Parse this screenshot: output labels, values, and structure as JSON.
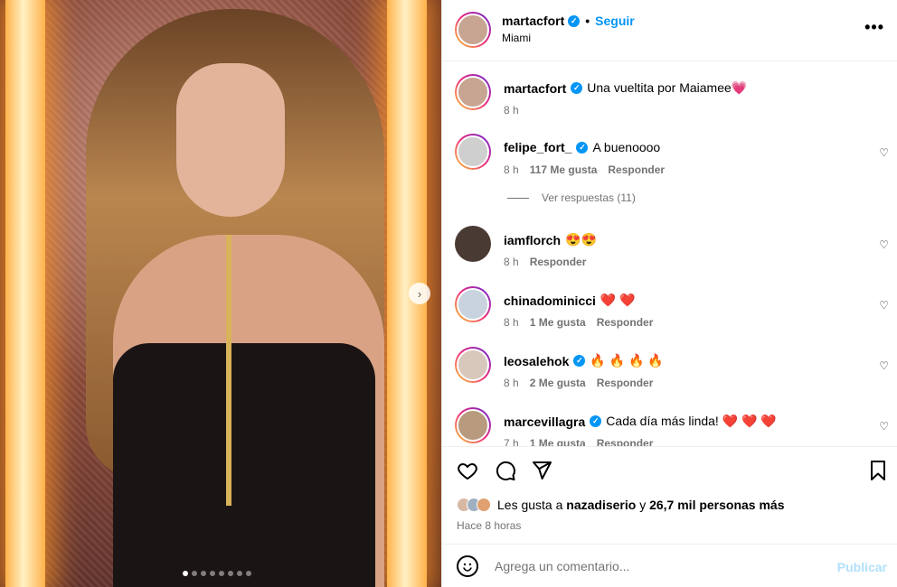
{
  "post": {
    "username": "martacfort",
    "location": "Miami",
    "follow_label": "Seguir",
    "more_icon": "more-horizontal-icon",
    "image_alt": "Photo",
    "carousel": {
      "slides": 8,
      "active": 1
    }
  },
  "caption": {
    "username": "martacfort",
    "text": "Una vueltita por Maiamee💗",
    "time": "8 h"
  },
  "comments": [
    {
      "username": "felipe_fort_",
      "verified": true,
      "text": "A buenoooo",
      "time": "8 h",
      "likes": "117 Me gusta",
      "reply": "Responder"
    },
    {
      "username": "iamflorch",
      "verified": false,
      "text": "😍😍",
      "time": "8 h",
      "likes": "",
      "reply": "Responder"
    },
    {
      "username": "chinadominicci",
      "verified": false,
      "text": "❤️ ❤️",
      "time": "8 h",
      "likes": "1 Me gusta",
      "reply": "Responder"
    },
    {
      "username": "leosalehok",
      "verified": true,
      "text": "🔥 🔥 🔥 🔥",
      "time": "8 h",
      "likes": "2 Me gusta",
      "reply": "Responder"
    },
    {
      "username": "marcevillagra",
      "verified": true,
      "text": "Cada día más linda! ❤️ ❤️ ❤️",
      "time": "7 h",
      "likes": "1 Me gusta",
      "reply": "Responder"
    }
  ],
  "view_replies": "Ver respuestas (11)",
  "likes": {
    "prefix": "Les gusta a",
    "user": "nazadiserio",
    "conj": "y",
    "others": "26,7 mil personas más"
  },
  "posted_ago": "Hace 8 horas",
  "add_comment": {
    "placeholder": "Agrega un comentario...",
    "publish": "Publicar"
  },
  "colors": {
    "accent": "#0095f6",
    "muted": "#737373"
  }
}
